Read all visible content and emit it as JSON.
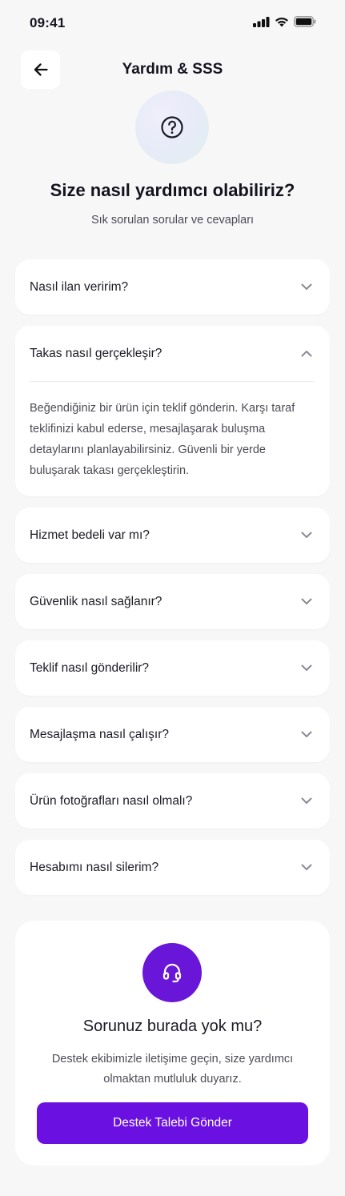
{
  "status_bar": {
    "time": "09:41"
  },
  "header": {
    "title": "Yardım & SSS"
  },
  "hero": {
    "title": "Size nasıl yardımcı olabiliriz?",
    "subtitle": "Sık sorulan sorular ve cevapları"
  },
  "faq": {
    "items": [
      {
        "question": "Nasıl ilan veririm?",
        "expanded": false
      },
      {
        "question": "Takas nasıl gerçekleşir?",
        "expanded": true,
        "answer": "Beğendiğiniz bir ürün için teklif gönderin. Karşı taraf teklifinizi kabul ederse, mesajlaşarak buluşma detaylarını planlayabilirsiniz. Güvenli bir yerde buluşarak takası gerçekleştirin."
      },
      {
        "question": "Hizmet bedeli var mı?",
        "expanded": false
      },
      {
        "question": "Güvenlik nasıl sağlanır?",
        "expanded": false
      },
      {
        "question": "Teklif nasıl gönderilir?",
        "expanded": false
      },
      {
        "question": "Mesajlaşma nasıl çalışır?",
        "expanded": false
      },
      {
        "question": "Ürün fotoğrafları nasıl olmalı?",
        "expanded": false
      },
      {
        "question": "Hesabımı nasıl silerim?",
        "expanded": false
      }
    ]
  },
  "support": {
    "title": "Sorunuz burada yok mu?",
    "text": "Destek ekibimizle iletişime geçin, size yardımcı olmaktan mutluluk duyarız.",
    "button_label": "Destek Talebi Gönder"
  },
  "colors": {
    "accent": "#6a10e0",
    "background": "#f7f7f8",
    "card": "#ffffff"
  }
}
